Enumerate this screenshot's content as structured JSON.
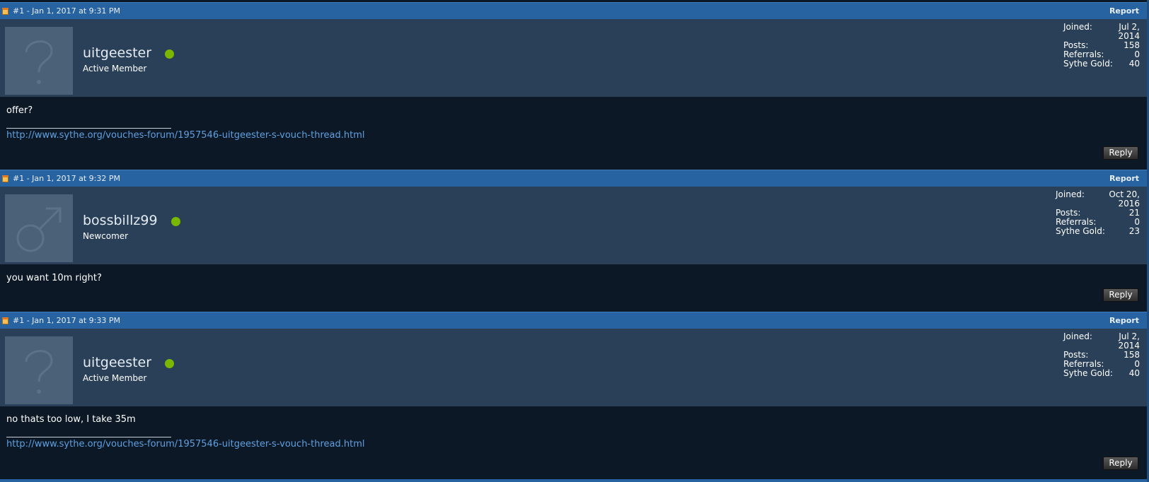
{
  "posts": [
    {
      "meta": "#1 - Jan 1, 2017 at 9:31 PM",
      "report_label": "Report",
      "username": "uitgeester",
      "rank": "Active Member",
      "avatar_icon": "question-mark-icon",
      "stats": {
        "joined_label": "Joined:",
        "joined_value": "Jul 2, 2014",
        "posts_label": "Posts:",
        "posts_value": "158",
        "referrals_label": "Referrals:",
        "referrals_value": "0",
        "gold_label": "Sythe Gold:",
        "gold_value": "40"
      },
      "message": "offer?",
      "signature_link": "http://www.sythe.org/vouches-forum/1957546-uitgeester-s-vouch-thread.html",
      "reply_label": "Reply"
    },
    {
      "meta": "#1 - Jan 1, 2017 at 9:32 PM",
      "report_label": "Report",
      "username": "bossbillz99",
      "rank": "Newcomer",
      "avatar_icon": "male-symbol-icon",
      "stats": {
        "joined_label": "Joined:",
        "joined_value": "Oct 20, 2016",
        "posts_label": "Posts:",
        "posts_value": "21",
        "referrals_label": "Referrals:",
        "referrals_value": "0",
        "gold_label": "Sythe Gold:",
        "gold_value": "23"
      },
      "message": "you want 10m right?",
      "reply_label": "Reply"
    },
    {
      "meta": "#1 - Jan 1, 2017 at 9:33 PM",
      "report_label": "Report",
      "username": "uitgeester",
      "rank": "Active Member",
      "avatar_icon": "question-mark-icon",
      "stats": {
        "joined_label": "Joined:",
        "joined_value": "Jul 2, 2014",
        "posts_label": "Posts:",
        "posts_value": "158",
        "referrals_label": "Referrals:",
        "referrals_value": "0",
        "gold_label": "Sythe Gold:",
        "gold_value": "40"
      },
      "message": "no thats too low, I take 35m",
      "signature_link": "http://www.sythe.org/vouches-forum/1957546-uitgeester-s-vouch-thread.html",
      "reply_label": "Reply"
    }
  ],
  "colors": {
    "header_bar": "#2763a0",
    "user_area": "#2a4058",
    "body_background": "#0c1826",
    "online_dot": "#7ab800",
    "link": "#5ea0e0"
  }
}
